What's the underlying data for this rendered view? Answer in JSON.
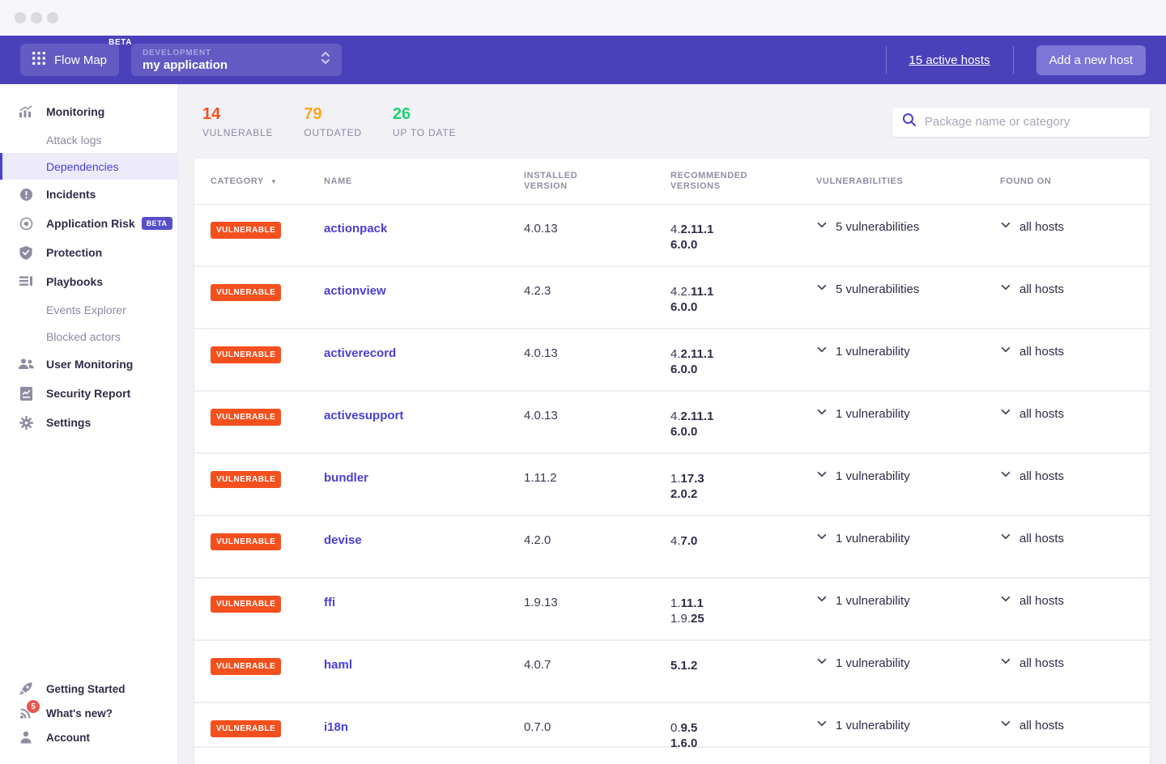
{
  "window": {
    "controls": [
      "close",
      "minimize",
      "maximize"
    ]
  },
  "header": {
    "flow_map_label": "Flow Map",
    "beta_label": "BETA",
    "env_label": "DEVELOPMENT",
    "app_name": "my application",
    "active_hosts_link": "15 active hosts",
    "add_host_button": "Add a new host"
  },
  "sidebar": {
    "items": [
      {
        "label": "Monitoring",
        "icon": "chart-icon",
        "type": "top"
      },
      {
        "label": "Attack logs",
        "type": "sub"
      },
      {
        "label": "Dependencies",
        "type": "sub",
        "selected": true
      },
      {
        "label": "Incidents",
        "icon": "incident-icon",
        "type": "top"
      },
      {
        "label": "Application Risk",
        "icon": "risk-icon",
        "type": "top",
        "badge": "BETA"
      },
      {
        "label": "Protection",
        "icon": "shield-icon",
        "type": "top"
      },
      {
        "label": "Playbooks",
        "icon": "playbook-icon",
        "type": "top"
      },
      {
        "label": "Events Explorer",
        "type": "sub"
      },
      {
        "label": "Blocked actors",
        "type": "sub"
      },
      {
        "label": "User Monitoring",
        "icon": "users-icon",
        "type": "top"
      },
      {
        "label": "Security Report",
        "icon": "report-icon",
        "type": "top"
      },
      {
        "label": "Settings",
        "icon": "gear-icon",
        "type": "top"
      }
    ],
    "footer_items": [
      {
        "label": "Getting Started",
        "icon": "rocket-icon"
      },
      {
        "label": "What's new?",
        "icon": "rss-icon",
        "badge": "5"
      },
      {
        "label": "Account",
        "icon": "person-icon"
      }
    ]
  },
  "stats": [
    {
      "value": "14",
      "label": "VULNERABLE",
      "color": "#f94f1c"
    },
    {
      "value": "79",
      "label": "OUTDATED",
      "color": "#ffa41b"
    },
    {
      "value": "26",
      "label": "UP TO DATE",
      "color": "#1ed36f"
    }
  ],
  "search": {
    "placeholder": "Package name or category"
  },
  "table": {
    "columns": [
      "CATEGORY",
      "NAME",
      "INSTALLED VERSION",
      "RECOMMENDED VERSIONS",
      "VULNERABILITIES",
      "FOUND ON"
    ],
    "rows": [
      {
        "category": "VULNERABLE",
        "name": "actionpack",
        "installed": "4.0.13",
        "recommended": [
          {
            "normal": "4.",
            "bold": "2.11.1"
          },
          {
            "normal": "",
            "bold": "6.0.0"
          }
        ],
        "vulnerabilities": "5 vulnerabilities",
        "found_on": "all hosts"
      },
      {
        "category": "VULNERABLE",
        "name": "actionview",
        "installed": "4.2.3",
        "recommended": [
          {
            "normal": "4.2.",
            "bold": "11.1"
          },
          {
            "normal": "",
            "bold": "6.0.0"
          }
        ],
        "vulnerabilities": "5 vulnerabilities",
        "found_on": "all hosts"
      },
      {
        "category": "VULNERABLE",
        "name": "activerecord",
        "installed": "4.0.13",
        "recommended": [
          {
            "normal": "4.",
            "bold": "2.11.1"
          },
          {
            "normal": "",
            "bold": "6.0.0"
          }
        ],
        "vulnerabilities": "1 vulnerability",
        "found_on": "all hosts"
      },
      {
        "category": "VULNERABLE",
        "name": "activesupport",
        "installed": "4.0.13",
        "recommended": [
          {
            "normal": "4.",
            "bold": "2.11.1"
          },
          {
            "normal": "",
            "bold": "6.0.0"
          }
        ],
        "vulnerabilities": "1 vulnerability",
        "found_on": "all hosts"
      },
      {
        "category": "VULNERABLE",
        "name": "bundler",
        "installed": "1.11.2",
        "recommended": [
          {
            "normal": "1.",
            "bold": "17.3"
          },
          {
            "normal": "",
            "bold": "2.0.2"
          }
        ],
        "vulnerabilities": "1 vulnerability",
        "found_on": "all hosts"
      },
      {
        "category": "VULNERABLE",
        "name": "devise",
        "installed": "4.2.0",
        "recommended": [
          {
            "normal": "4.",
            "bold": "7.0"
          }
        ],
        "vulnerabilities": "1 vulnerability",
        "found_on": "all hosts"
      },
      {
        "category": "VULNERABLE",
        "name": "ffi",
        "installed": "1.9.13",
        "recommended": [
          {
            "normal": "1.",
            "bold": "11.1"
          },
          {
            "normal": "1.9.",
            "bold": "25"
          }
        ],
        "vulnerabilities": "1 vulnerability",
        "found_on": "all hosts"
      },
      {
        "category": "VULNERABLE",
        "name": "haml",
        "installed": "4.0.7",
        "recommended": [
          {
            "normal": "",
            "bold": "5.1.2"
          }
        ],
        "vulnerabilities": "1 vulnerability",
        "found_on": "all hosts"
      },
      {
        "category": "VULNERABLE",
        "name": "i18n",
        "installed": "0.7.0",
        "recommended": [
          {
            "normal": "0.",
            "bold": "9.5"
          },
          {
            "normal": "",
            "bold": "1.6.0"
          }
        ],
        "vulnerabilities": "1 vulnerability",
        "found_on": "all hosts"
      }
    ]
  },
  "colors": {
    "topbar": "#4a41ba",
    "accent": "#4b3fd4",
    "vulnerable_badge": "#f4501e"
  }
}
